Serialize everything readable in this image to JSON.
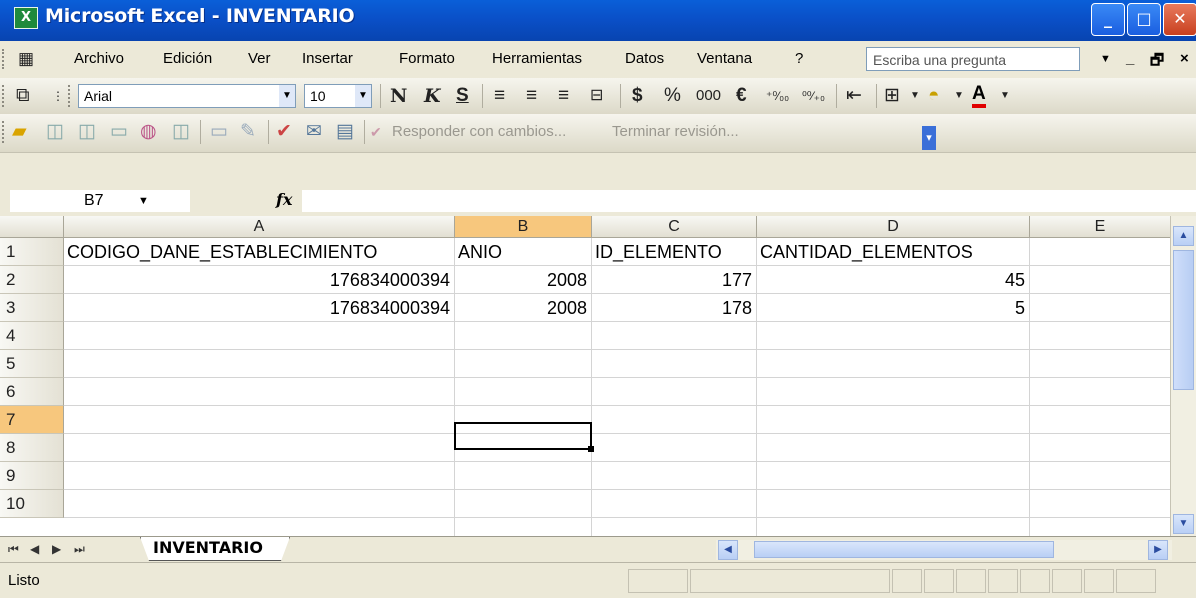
{
  "window": {
    "title": "Microsoft Excel - INVENTARIO",
    "app_icon": "X"
  },
  "menu": {
    "items": [
      "Archivo",
      "Edición",
      "Ver",
      "Insertar",
      "Formato",
      "Herramientas",
      "Datos",
      "Ventana",
      "?"
    ],
    "ask_placeholder": "Escriba una pregunta"
  },
  "format_toolbar": {
    "font_name": "Arial",
    "font_size": "10",
    "bold": "N",
    "italic": "K",
    "underline": "S",
    "currency": "$",
    "percent": "%",
    "thousands": "000",
    "euro": "€",
    "increase_decimal": "⁺⁰⁄₀₀",
    "decrease_decimal": "⁰⁰⁄₊₀"
  },
  "review_toolbar": {
    "reply_label": "Responder con cambios...",
    "end_review_label": "Terminar revisión..."
  },
  "formula_bar": {
    "name_box": "B7",
    "fx_symbol": "fx",
    "formula": ""
  },
  "sheet": {
    "columns": [
      "A",
      "B",
      "C",
      "D",
      "E"
    ],
    "selected_column": "B",
    "row_numbers": [
      "1",
      "2",
      "3",
      "4",
      "5",
      "6",
      "7",
      "8",
      "9",
      "10"
    ],
    "selected_row": "7",
    "rows": [
      {
        "a": "CODIGO_DANE_ESTABLECIMIENTO",
        "b": "ANIO",
        "c": "ID_ELEMENTO",
        "d": "CANTIDAD_ELEMENTOS"
      },
      {
        "a": "176834000394",
        "b": "2008",
        "c": "177",
        "d": "45"
      },
      {
        "a": "176834000394",
        "b": "2008",
        "c": "178",
        "d": "5"
      }
    ]
  },
  "sheet_tabs": {
    "active": "INVENTARIO"
  },
  "status": {
    "text": "Listo"
  },
  "colors": {
    "title_bar": "#0a54d0",
    "selected_header": "#f7c77d",
    "chrome": "#ece9d8"
  }
}
